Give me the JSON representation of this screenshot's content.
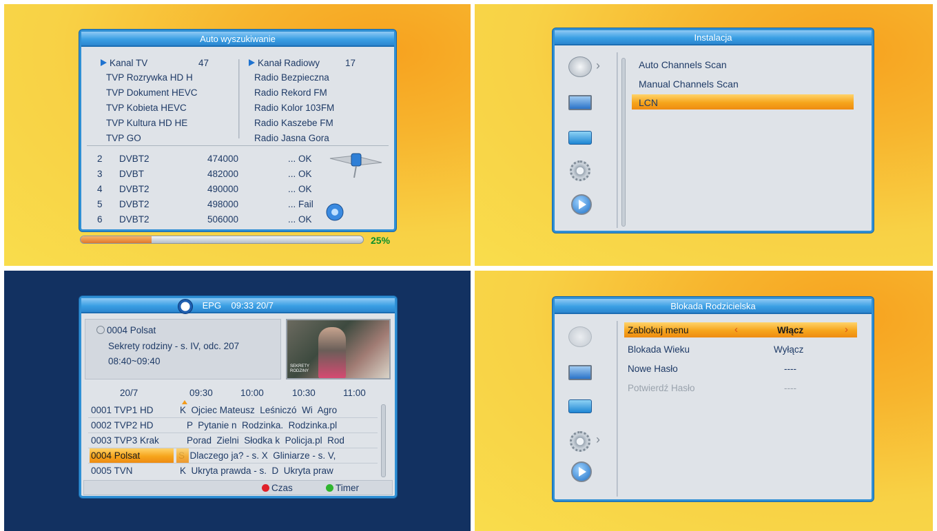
{
  "autoscan": {
    "title": "Auto wyszukiwanie",
    "tv_header": "Kanal TV",
    "tv_count": "47",
    "radio_header": "Kanał Radiowy",
    "radio_count": "17",
    "tv_channels": [
      "TVP Rozrywka HD H",
      "TVP Dokument HEVC",
      "TVP Kobieta HEVC",
      "TVP Kultura HD HE",
      "TVP GO"
    ],
    "radio_channels": [
      "Radio Bezpieczna",
      "Radio Rekord FM",
      "Radio Kolor 103FM",
      "Radio Kaszebe FM",
      "Radio Jasna Gora"
    ],
    "scan_rows": [
      {
        "num": "2",
        "type": "DVBT2",
        "freq": "474000",
        "status": "... OK"
      },
      {
        "num": "3",
        "type": "DVBT",
        "freq": "482000",
        "status": "... OK"
      },
      {
        "num": "4",
        "type": "DVBT2",
        "freq": "490000",
        "status": "... OK"
      },
      {
        "num": "5",
        "type": "DVBT2",
        "freq": "498000",
        "status": "... Fail"
      },
      {
        "num": "6",
        "type": "DVBT2",
        "freq": "506000",
        "status": "... OK"
      }
    ],
    "progress": 0.25,
    "progress_label": "25%"
  },
  "install": {
    "title": "Instalacja",
    "items": [
      "Auto Channels Scan",
      "Manual Channels Scan",
      "LCN"
    ],
    "selected": 2
  },
  "epg": {
    "title": "EPG",
    "time": "09:33 20/7",
    "channel": "0004 Polsat",
    "program": "Sekrety rodziny - s. IV, odc. 207",
    "program_time": "08:40~09:40",
    "preview_caption": "SEKRETY RODZINY",
    "timeline": [
      "20/7",
      "09:30",
      "10:00",
      "10:30",
      "11:00"
    ],
    "rows": [
      {
        "channel": "0001 TVP1 HD",
        "programs": "K  Ojciec Mateusz  Leśniczó  Wi  Agro"
      },
      {
        "channel": "0002 TVP2 HD",
        "programs": "P  Pytanie n  Rodzinka.  Rodzinka.pl"
      },
      {
        "channel": "0003 TVP3 Krak",
        "programs": "Porad  Zielni  Słodka k  Policja.pl  Rod"
      },
      {
        "channel": "0004 Polsat",
        "programs": "S  Dlaczego ja? - s. X  Gliniarze - s. V,"
      },
      {
        "channel": "0005 TVN",
        "programs": "K  Ukryta prawda - s.  D  Ukryta praw"
      }
    ],
    "selected_row": 3,
    "red_label": "Czas",
    "green_label": "Timer",
    "colors": {
      "red": "#e0212a",
      "green": "#2fb52f"
    }
  },
  "parental": {
    "title": "Blokada Rodzicielska",
    "rows": [
      {
        "label": "Zablokuj menu",
        "value": "Włącz"
      },
      {
        "label": "Blokada Wieku",
        "value": "Wyłącz"
      },
      {
        "label": "Nowe Hasło",
        "value": "----"
      },
      {
        "label": "Potwierdź Hasło",
        "value": "----"
      }
    ]
  },
  "icons": [
    "satellite-dish-icon",
    "tv-icon",
    "toolbox-icon",
    "gear-icon",
    "play-icon"
  ]
}
